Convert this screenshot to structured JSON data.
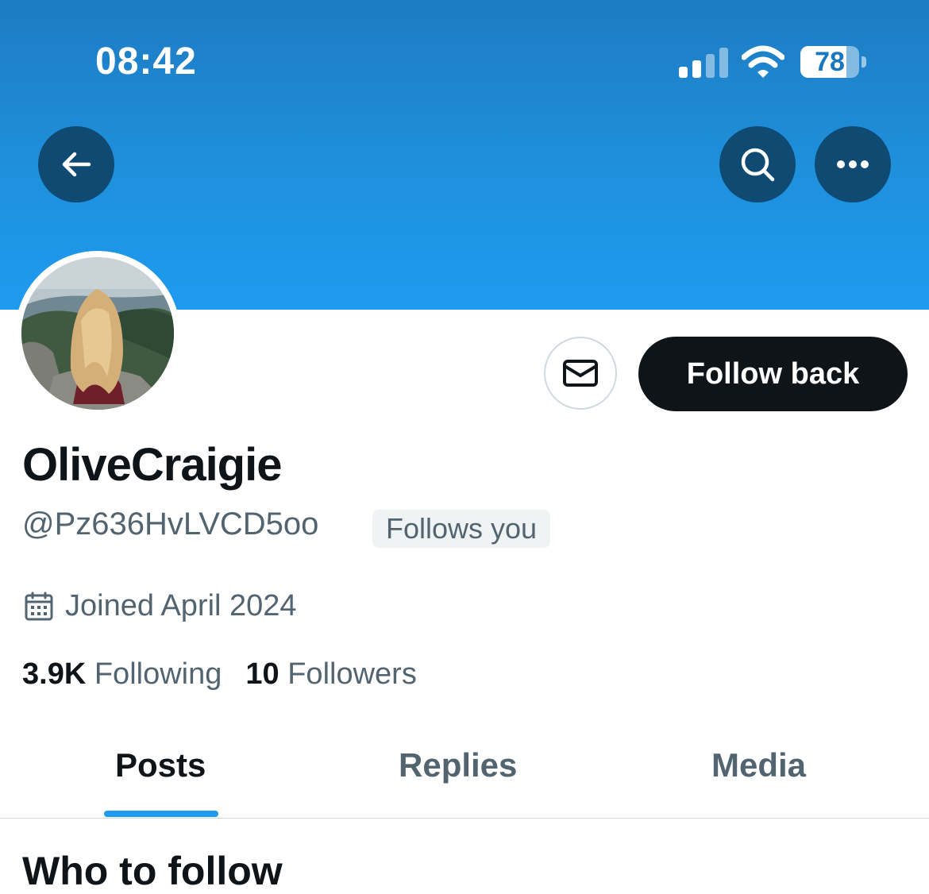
{
  "status_bar": {
    "time": "08:42",
    "battery_level": "78",
    "battery_fraction": 0.78,
    "signal_bars_active": 2,
    "signal_bars_total": 4
  },
  "header": {
    "back_icon": "arrow-left-icon",
    "search_icon": "search-icon",
    "more_icon": "more-horizontal-icon",
    "banner_color": "#1d9bf0"
  },
  "profile": {
    "display_name": "OliveCraigie",
    "handle": "@Pz636HvLVCD5oo",
    "follows_you_badge": "Follows you",
    "joined": "Joined April 2024",
    "following_count": "3.9K",
    "following_label": "Following",
    "followers_count": "10",
    "followers_label": "Followers"
  },
  "actions": {
    "message_icon": "envelope-icon",
    "follow_back_label": "Follow back"
  },
  "tabs": [
    {
      "label": "Posts",
      "active": true
    },
    {
      "label": "Replies",
      "active": false
    },
    {
      "label": "Media",
      "active": false
    }
  ],
  "sections": {
    "who_to_follow": "Who to follow"
  },
  "colors": {
    "accent": "#1d9bf0",
    "primary_text": "#0f1419",
    "secondary_text": "#536471",
    "button_dark": "#0f1419"
  }
}
